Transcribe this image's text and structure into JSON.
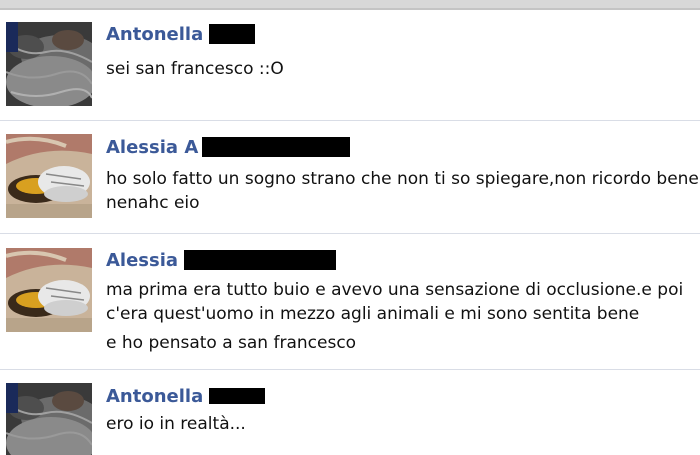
{
  "messages": [
    {
      "author": "Antonella",
      "avatar_icon": "cat-fur-photo-icon",
      "lines": [
        "sei san francesco ::O"
      ]
    },
    {
      "author": "Alessia A",
      "avatar_icon": "shoes-photo-icon",
      "lines": [
        "ho solo fatto un sogno strano che non ti so spiegare,non ricordo bene",
        "nenahc eio"
      ]
    },
    {
      "author": "Alessia",
      "avatar_icon": "shoes-photo-icon",
      "lines": [
        "ma prima era tutto buio e avevo una sensazione di occlusione.e poi",
        "c'era quest'uomo in mezzo agli animali e mi sono sentita bene",
        "e ho pensato a san francesco"
      ]
    },
    {
      "author": "Antonella",
      "avatar_icon": "cat-fur-photo-icon",
      "lines": [
        "ero io in realtà..."
      ]
    }
  ],
  "colors": {
    "author_name": "#3b5998",
    "separator": "#d9dde6",
    "text": "#111111"
  }
}
